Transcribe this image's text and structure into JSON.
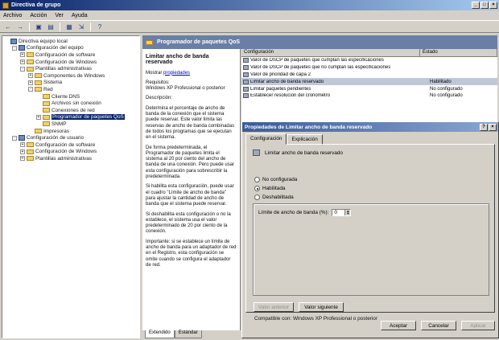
{
  "window": {
    "title": "Directiva de grupo"
  },
  "menu": [
    "Archivo",
    "Acción",
    "Ver",
    "Ayuda"
  ],
  "toolbar": [
    "back-icon",
    "forward-icon",
    "up-icon",
    "show-tree-icon",
    "properties-icon",
    "export-icon",
    "help-icon"
  ],
  "tree": [
    {
      "label": "Directiva equipo local",
      "indent": 0,
      "exp": "",
      "icon": "gpo"
    },
    {
      "label": "Configuración del equipo",
      "indent": 1,
      "exp": "-",
      "icon": "gpo"
    },
    {
      "label": "Configuración de software",
      "indent": 2,
      "exp": "+",
      "icon": "folder"
    },
    {
      "label": "Configuración de Windows",
      "indent": 2,
      "exp": "+",
      "icon": "folder"
    },
    {
      "label": "Plantillas administrativas",
      "indent": 2,
      "exp": "-",
      "icon": "folder"
    },
    {
      "label": "Componentes de Windows",
      "indent": 3,
      "exp": "+",
      "icon": "folder"
    },
    {
      "label": "Sistema",
      "indent": 3,
      "exp": "+",
      "icon": "folder"
    },
    {
      "label": "Red",
      "indent": 3,
      "exp": "-",
      "icon": "folder"
    },
    {
      "label": "Cliente DNS",
      "indent": 4,
      "exp": "",
      "icon": "folder"
    },
    {
      "label": "Archivos sin conexión",
      "indent": 4,
      "exp": "",
      "icon": "folder"
    },
    {
      "label": "Conexiones de red",
      "indent": 4,
      "exp": "",
      "icon": "folder"
    },
    {
      "label": "Programador de paquetes QoS",
      "indent": 4,
      "exp": "+",
      "icon": "folder",
      "selected": true
    },
    {
      "label": "SNMP",
      "indent": 4,
      "exp": "",
      "icon": "folder"
    },
    {
      "label": "Impresoras",
      "indent": 3,
      "exp": "",
      "icon": "folder"
    },
    {
      "label": "Configuración de usuario",
      "indent": 1,
      "exp": "-",
      "icon": "gpo"
    },
    {
      "label": "Configuración de software",
      "indent": 2,
      "exp": "+",
      "icon": "folder"
    },
    {
      "label": "Configuración de Windows",
      "indent": 2,
      "exp": "+",
      "icon": "folder"
    },
    {
      "label": "Plantillas administrativas",
      "indent": 2,
      "exp": "+",
      "icon": "folder"
    }
  ],
  "pane_header": "Programador de paquetes QoS",
  "description": {
    "title": "Limitar ancho de banda reservado",
    "show_label": "Mostrar",
    "show_link": "propiedades",
    "requirements": "Requisitos:",
    "requirements_value": "Windows XP Professional o posterior",
    "paragraphs": [
      "Descripción:",
      "Determina el porcentaje de ancho de banda de la conexión que el sistema puede reservar. Este valor limita las reservas de ancho de banda combinadas de todos los programas que se ejecutan en el sistema.",
      "De forma predeterminada, el Programador de paquetes limita el sistema al 20 por ciento del ancho de banda de una conexión. Pero puede usar esta configuración para sobrescribir la predeterminada.",
      "Si habilita esta configuración, puede usar el cuadro \"Límite de ancho de banda\" para ajustar la cantidad de ancho de banda que el sistema puede reservar.",
      "Si deshabilita esta configuración o no la establece, el sistema usa el valor predeterminado de 20 por ciento de la conexión.",
      "Importante: si se establece un límite de ancho de banda para un adaptador de red en el Registro, esta configuración se omite cuando se configura el adaptador de red."
    ]
  },
  "tabs": [
    "Extendido",
    "Estándar"
  ],
  "list": {
    "headers": [
      "Configuración",
      "Estado"
    ],
    "rows": [
      {
        "name": "Valor de DSCP de paquetes que cumplan las especificaciones",
        "state": ""
      },
      {
        "name": "Valor de DSCP de paquetes que no cumplan las especificaciones",
        "state": ""
      },
      {
        "name": "Valor de prioridad de capa 2",
        "state": ""
      },
      {
        "name": "Limitar ancho de banda reservado",
        "state": "Habilitado",
        "selected": true
      },
      {
        "name": "Limitar paquetes pendientes",
        "state": "No configurado"
      },
      {
        "name": "Establecer resolución del cronómetro",
        "state": "No configurado"
      }
    ]
  },
  "dialog": {
    "title": "Propiedades de Limitar ancho de banda reservado",
    "tabs": [
      "Configuración",
      "Explicación"
    ],
    "policy_name": "Limitar ancho de banda reservado",
    "options": [
      "No configurada",
      "Habilitada",
      "Deshabilitada"
    ],
    "selected_option": "Habilitada",
    "limit_label": "Límite de ancho de banda (%):",
    "limit_value": "0",
    "compat": "Compatible con: Windows XP Professional o posterior",
    "prev_button": "Valor anterior",
    "next_button": "Valor siguiente",
    "ok_button": "Aceptar",
    "cancel_button": "Cancelar",
    "apply_button": "Aplicar"
  },
  "colors": {
    "titlebar": "#0a246a",
    "header": "#6b7fa6",
    "selection": "#0a246a"
  }
}
